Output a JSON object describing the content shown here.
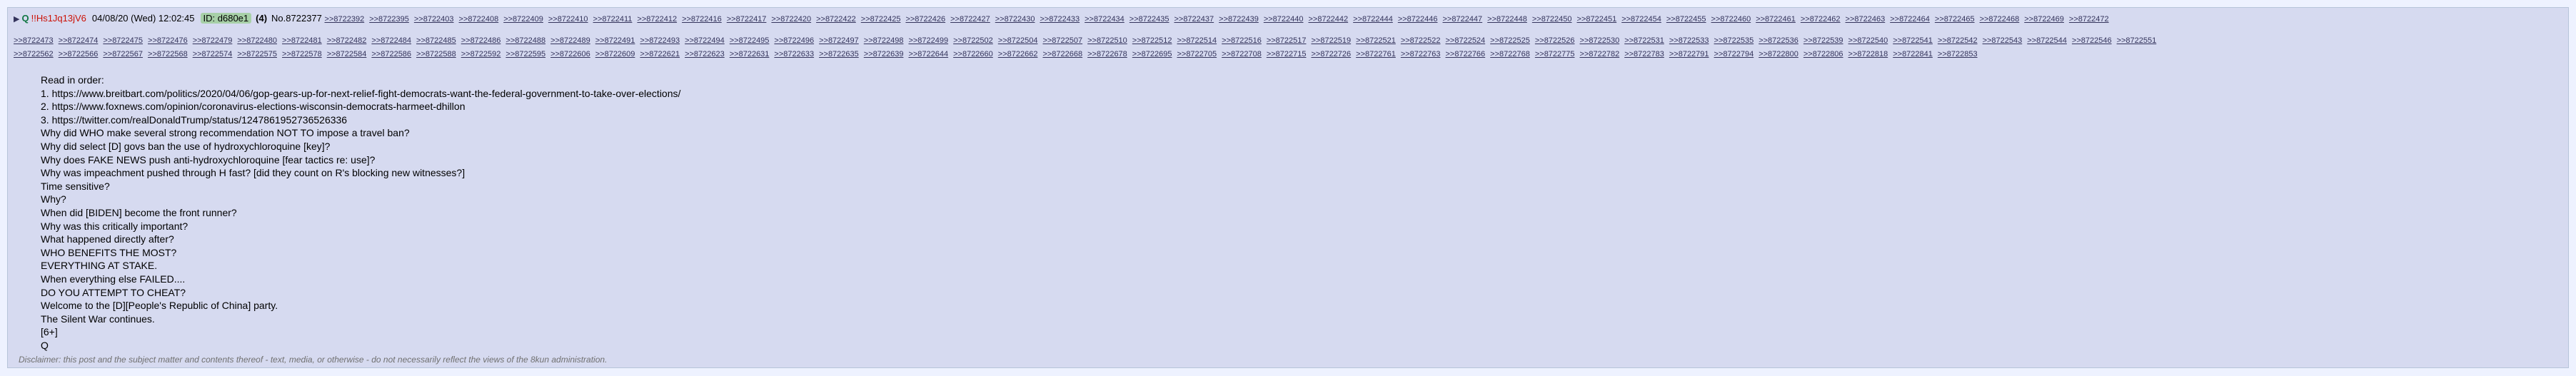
{
  "post": {
    "arrow": "▶",
    "name": "Q",
    "trip": "!!Hs1Jq13jV6",
    "date": "04/08/20 (Wed) 12:02:45",
    "id_label": "ID:",
    "id_value": "d680e1",
    "count": "(4)",
    "post_no": "No.8722377"
  },
  "replies_row1": [
    ">>8722392",
    ">>8722395",
    ">>8722403",
    ">>8722408",
    ">>8722409",
    ">>8722410",
    ">>8722411",
    ">>8722412",
    ">>8722416",
    ">>8722417",
    ">>8722420",
    ">>8722422",
    ">>8722425",
    ">>8722426",
    ">>8722427",
    ">>8722430",
    ">>8722433",
    ">>8722434",
    ">>8722435",
    ">>8722437",
    ">>8722439",
    ">>8722440",
    ">>8722442",
    ">>8722444",
    ">>8722446",
    ">>8722447",
    ">>8722448",
    ">>8722450",
    ">>8722451",
    ">>8722454",
    ">>8722455",
    ">>8722460",
    ">>8722461",
    ">>8722462",
    ">>8722463",
    ">>8722464",
    ">>8722465",
    ">>8722468",
    ">>8722469",
    ">>8722472"
  ],
  "replies_row2": [
    ">>8722473",
    ">>8722474",
    ">>8722475",
    ">>8722476",
    ">>8722479",
    ">>8722480",
    ">>8722481",
    ">>8722482",
    ">>8722484",
    ">>8722485",
    ">>8722486",
    ">>8722488",
    ">>8722489",
    ">>8722491",
    ">>8722493",
    ">>8722494",
    ">>8722495",
    ">>8722496",
    ">>8722497",
    ">>8722498",
    ">>8722499",
    ">>8722502",
    ">>8722504",
    ">>8722507",
    ">>8722510",
    ">>8722512",
    ">>8722514",
    ">>8722516",
    ">>8722517",
    ">>8722519",
    ">>8722521",
    ">>8722522",
    ">>8722524",
    ">>8722525",
    ">>8722526",
    ">>8722530",
    ">>8722531",
    ">>8722533",
    ">>8722535",
    ">>8722536",
    ">>8722539",
    ">>8722540",
    ">>8722541",
    ">>8722542",
    ">>8722543",
    ">>8722544",
    ">>8722546",
    ">>8722551"
  ],
  "replies_row3": [
    ">>8722562",
    ">>8722566",
    ">>8722567",
    ">>8722568",
    ">>8722574",
    ">>8722575",
    ">>8722578",
    ">>8722584",
    ">>8722586",
    ">>8722588",
    ">>8722592",
    ">>8722595",
    ">>8722606",
    ">>8722609",
    ">>8722621",
    ">>8722623",
    ">>8722631",
    ">>8722633",
    ">>8722635",
    ">>8722639",
    ">>8722644",
    ">>8722660",
    ">>8722662",
    ">>8722668",
    ">>8722678",
    ">>8722695",
    ">>8722705",
    ">>8722708",
    ">>8722715",
    ">>8722726",
    ">>8722761",
    ">>8722763",
    ">>8722766",
    ">>8722768",
    ">>8722775",
    ">>8722782",
    ">>8722783",
    ">>8722791",
    ">>8722794",
    ">>8722800",
    ">>8722806",
    ">>8722818",
    ">>8722841",
    ">>8722853"
  ],
  "body_lines": [
    "Read in order:",
    "1. https://www.breitbart.com/politics/2020/04/06/gop-gears-up-for-next-relief-fight-democrats-want-the-federal-government-to-take-over-elections/",
    "2. https://www.foxnews.com/opinion/coronavirus-elections-wisconsin-democrats-harmeet-dhillon",
    "3. https://twitter.com/realDonaldTrump/status/1247861952736526336",
    "Why did WHO make several strong recommendation NOT TO impose a travel ban?",
    "Why did select [D] govs ban the use of hydroxychloroquine [key]?",
    "Why does FAKE NEWS push anti-hydroxychloroquine [fear tactics re: use]?",
    "Why was impeachment pushed through H fast? [did they count on R's blocking new witnesses?]",
    "Time sensitive?",
    "Why?",
    "When did [BIDEN] become the front runner?",
    "Why was this critically important?",
    "What happened directly after?",
    "WHO BENEFITS THE MOST?",
    "EVERYTHING AT STAKE.",
    "When everything else FAILED....",
    "DO YOU ATTEMPT TO CHEAT?",
    "Welcome to the [D][People's Republic of China] party.",
    "The Silent War continues.",
    "[6+]",
    "Q"
  ],
  "disclaimer": "Disclaimer: this post and the subject matter and contents thereof - text, media, or otherwise - do not necessarily reflect the views of the 8kun administration."
}
